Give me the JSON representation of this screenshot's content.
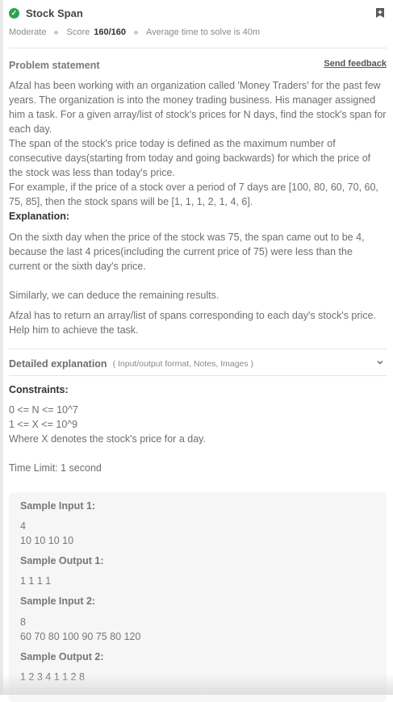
{
  "problem": {
    "title": "Stock Span",
    "difficulty": "Moderate",
    "score_label": "Score",
    "score_value": "160/160",
    "avg_time": "Average time to solve is 40m"
  },
  "statement": {
    "heading": "Problem statement",
    "feedback_link": "Send feedback",
    "para1": "Afzal has been working with an organization called 'Money Traders' for the past few years. The organization is into the money trading business. His manager assigned him a task. For a given array/list of stock's prices for N days, find the stock's span for each day.",
    "para2": "The span of the stock's price today is defined as the maximum number of consecutive days(starting from today and going backwards) for which the price of the stock was less than today's price.",
    "para3": "For example, if the price of a stock over a period of 7 days are [100, 80, 60, 70, 60, 75, 85], then the stock spans will be [1, 1, 1, 2, 1, 4, 6].",
    "explanation_label": "Explanation:",
    "explanation": "On the sixth day when the price of the stock was 75, the span came out to be 4, because the last 4 prices(including the current price of 75) were less than the current or the sixth day's price.",
    "similarly": "Similarly, we can deduce the remaining results.",
    "task": "Afzal has to return an array/list of spans corresponding to each day's stock's price. Help him to achieve the task."
  },
  "detailed": {
    "label": "Detailed explanation",
    "sub": "( Input/output format, Notes, Images )"
  },
  "constraints": {
    "label": "Constraints:",
    "line1": "0 <= N <= 10^7",
    "line2": "1 <= X <= 10^9",
    "line3": "Where X denotes the stock's price for a day.",
    "time_limit": "Time Limit: 1 second"
  },
  "samples": {
    "in1_label": "Sample Input 1:",
    "in1_l1": "4",
    "in1_l2": "10 10 10 10",
    "out1_label": "Sample Output 1:",
    "out1_l1": "1 1 1 1",
    "in2_label": "Sample Input 2:",
    "in2_l1": "8",
    "in2_l2": "60 70 80 100 90 75 80 120",
    "out2_label": "Sample Output 2:",
    "out2_l1": "1 2 3 4 1 1 2 8"
  },
  "colors": {
    "check": "#2ca44f",
    "sample_bg": "#f6f6f6"
  },
  "icons": [
    "check-circle-icon",
    "bookmark-add-icon",
    "chevron-down-icon"
  ]
}
